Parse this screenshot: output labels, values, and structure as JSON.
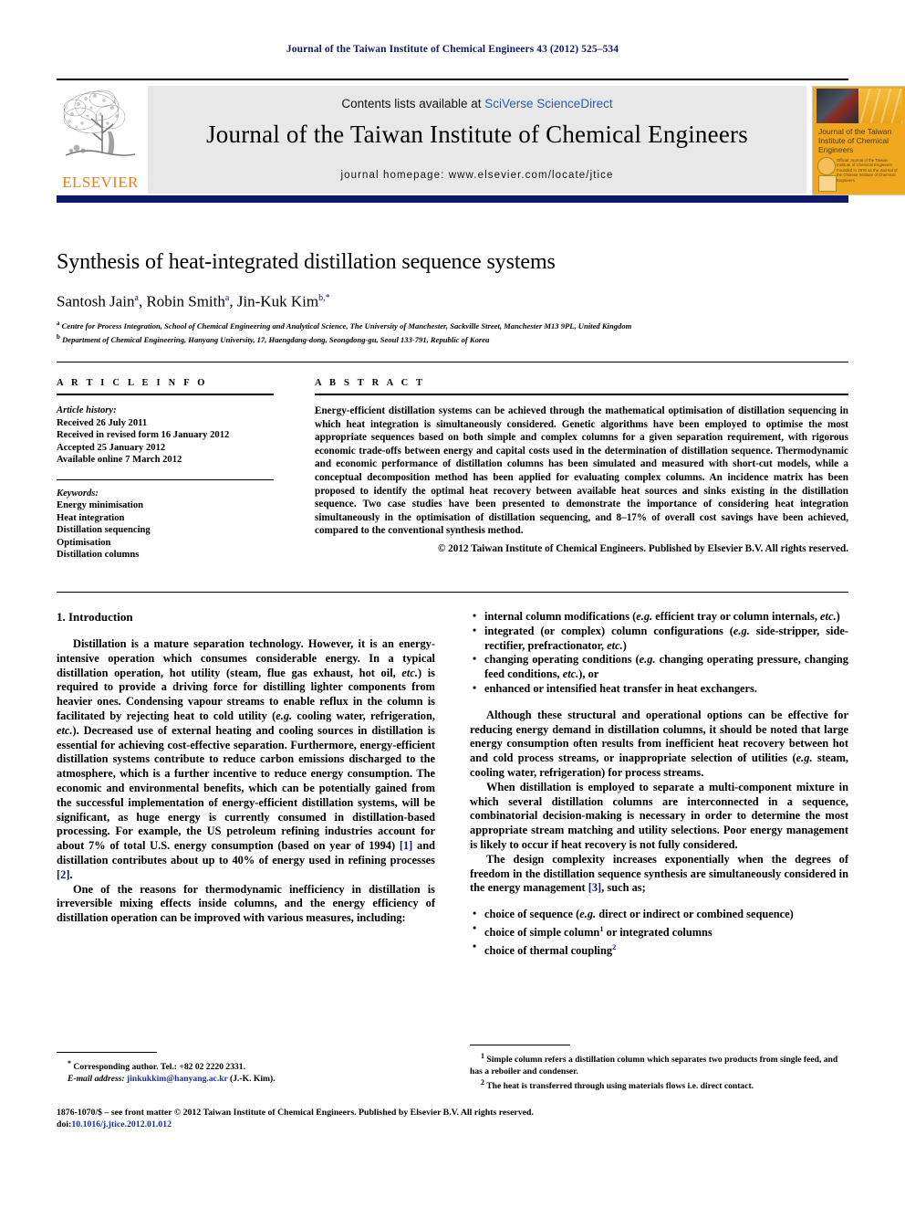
{
  "running_head": "Journal of the Taiwan Institute of Chemical Engineers 43 (2012) 525–534",
  "masthead": {
    "contents_prefix": "Contents lists available at ",
    "sciencedirect": "SciVerse ScienceDirect",
    "journal_name": "Journal of the Taiwan Institute of Chemical Engineers",
    "homepage": "journal homepage: www.elsevier.com/locate/jtice",
    "publisher_logo": "ELSEVIER",
    "cover_title": "Journal of the Taiwan Institute of Chemical Engineers",
    "cover_meta": "Official Journal of the Taiwan Institute of Chemical Engineers Founded in 1970 as the Journal of the Chinese Institute of Chemical Engineers"
  },
  "article": {
    "title": "Synthesis of heat-integrated distillation sequence systems",
    "authors": "Santosh Jain, Robin Smith, Jin-Kuk Kim",
    "author_list": [
      {
        "name": "Santosh Jain",
        "mark": "a"
      },
      {
        "name": "Robin Smith",
        "mark": "a"
      },
      {
        "name": "Jin-Kuk Kim",
        "mark": "b,*"
      }
    ],
    "affiliations": [
      {
        "mark": "a",
        "text": "Centre for Process Integration, School of Chemical Engineering and Analytical Science, The University of Manchester, Sackville Street, Manchester M13 9PL, United Kingdom"
      },
      {
        "mark": "b",
        "text": "Department of Chemical Engineering, Hanyang University, 17, Haengdang-dong, Seongdong-gu, Seoul 133-791, Republic of Korea"
      }
    ]
  },
  "article_info": {
    "heading": "A R T I C L E  I N F O",
    "history_label": "Article history:",
    "history": [
      "Received 26 July 2011",
      "Received in revised form 16 January 2012",
      "Accepted 25 January 2012",
      "Available online 7 March 2012"
    ],
    "keywords_label": "Keywords:",
    "keywords": [
      "Energy minimisation",
      "Heat integration",
      "Distillation sequencing",
      "Optimisation",
      "Distillation columns"
    ]
  },
  "abstract": {
    "heading": "A B S T R A C T",
    "text": "Energy-efficient distillation systems can be achieved through the mathematical optimisation of distillation sequencing in which heat integration is simultaneously considered. Genetic algorithms have been employed to optimise the most appropriate sequences based on both simple and complex columns for a given separation requirement, with rigorous economic trade-offs between energy and capital costs used in the determination of distillation sequence. Thermodynamic and economic performance of distillation columns has been simulated and measured with short-cut models, while a conceptual decomposition method has been applied for evaluating complex columns. An incidence matrix has been proposed to identify the optimal heat recovery between available heat sources and sinks existing in the distillation sequence. Two case studies have been presented to demonstrate the importance of considering heat integration simultaneously in the optimisation of distillation sequencing, and 8–17% of overall cost savings have been achieved, compared to the conventional synthesis method.",
    "copyright": "© 2012 Taiwan Institute of Chemical Engineers. Published by Elsevier B.V. All rights reserved."
  },
  "introduction": {
    "heading": "1. Introduction",
    "para1_a": "Distillation is a mature separation technology. However, it is an energy-intensive operation which consumes considerable energy. In a typical distillation operation, hot utility (steam, flue gas exhaust, hot oil, ",
    "para1_i1": "etc.",
    "para1_b": ") is required to provide a driving force for distilling lighter components from heavier ones. Condensing vapour streams to enable reflux in the column is facilitated by rejecting heat to cold utility (",
    "para1_i2": "e.g.",
    "para1_c": " cooling water, refrigeration, ",
    "para1_i3": "etc.",
    "para1_d": "). Decreased use of external heating and cooling sources in distillation is essential for achieving cost-effective separation. Furthermore, energy-efficient distillation systems contribute to reduce carbon emissions discharged to the atmosphere, which is a further incentive to reduce energy consumption. The economic and environmental benefits, which can be potentially gained from the successful implementation of energy-efficient distillation systems, will be significant, as huge energy is currently consumed in distillation-based processing. For example, the US petroleum refining industries account for about 7% of total U.S. energy consumption (based on year of 1994) ",
    "para1_ref1": "[1]",
    "para1_e": " and distillation contributes about up to 40% of energy used in refining processes ",
    "para1_ref2": "[2]",
    "para1_f": ".",
    "para2": "One of the reasons for thermodynamic inefficiency in distillation is irreversible mixing effects inside columns, and the energy efficiency of distillation operation can be improved with various measures, including:"
  },
  "measures_bullets": [
    {
      "a": "internal column modifications (",
      "i": "e.g.",
      "b": " efficient tray or column internals, ",
      "i2": "etc.",
      "c": ")"
    },
    {
      "a": "integrated (or complex) column configurations (",
      "i": "e.g.",
      "b": " side-stripper, side-rectifier, prefractionator, ",
      "i2": "etc.",
      "c": ")"
    },
    {
      "a": "changing operating conditions (",
      "i": "e.g.",
      "b": " changing operating pressure, changing feed conditions, ",
      "i2": "etc.",
      "c": "), or"
    },
    {
      "a": "enhanced or intensified heat transfer in heat exchangers.",
      "i": "",
      "b": "",
      "i2": "",
      "c": ""
    }
  ],
  "right_column": {
    "para1_a": "Although these structural and operational options can be effective for reducing energy demand in distillation columns, it should be noted that large energy consumption often results from inefficient heat recovery between hot and cold process streams, or inappropriate selection of utilities (",
    "para1_i": "e.g.",
    "para1_b": " steam, cooling water, refrigeration) for process streams.",
    "para2": "When distillation is employed to separate a multi-component mixture in which several distillation columns are interconnected in a sequence, combinatorial decision-making is necessary in order to determine the most appropriate stream matching and utility selections. Poor energy management is likely to occur if heat recovery is not fully considered.",
    "para3_a": "The design complexity increases exponentially when the degrees of freedom in the distillation sequence synthesis are simultaneously considered in the energy management ",
    "para3_ref": "[3]",
    "para3_b": ", such as;"
  },
  "choice_bullets": [
    {
      "a": "choice of sequence (",
      "i": "e.g.",
      "b": " direct or indirect or combined sequence)",
      "sup": ""
    },
    {
      "a": "choice of simple column",
      "i": "",
      "b": " or integrated columns",
      "sup": "1"
    },
    {
      "a": "choice of thermal coupling",
      "i": "",
      "b": "",
      "sup": "2"
    }
  ],
  "footnotes": {
    "left": {
      "corresponding_mark": "*",
      "corresponding": "Corresponding author. Tel.: +82 02 2220 2331.",
      "email_label": "E-mail address:",
      "email": "jinkukkim@hanyang.ac.kr",
      "email_suffix": "(J.-K. Kim)."
    },
    "right": [
      {
        "mark": "1",
        "text": "Simple column refers a distillation column which separates two products from single feed, and has a reboiler and condenser."
      },
      {
        "mark": "2",
        "text": "The heat is transferred through using materials flows i.e. direct contact."
      }
    ]
  },
  "imprint": {
    "line1": "1876-1070/$ – see front matter © 2012 Taiwan Institute of Chemical Engineers. Published by Elsevier B.V. All rights reserved.",
    "doi_label": "doi:",
    "doi": "10.1016/j.jtice.2012.01.012"
  },
  "colors": {
    "link": "#2b5ea8",
    "navy": "#0e1a66",
    "elsevier_orange": "#f07d18",
    "band_gray": "#e8e8e8",
    "cover_orange": "#f0a81e"
  }
}
